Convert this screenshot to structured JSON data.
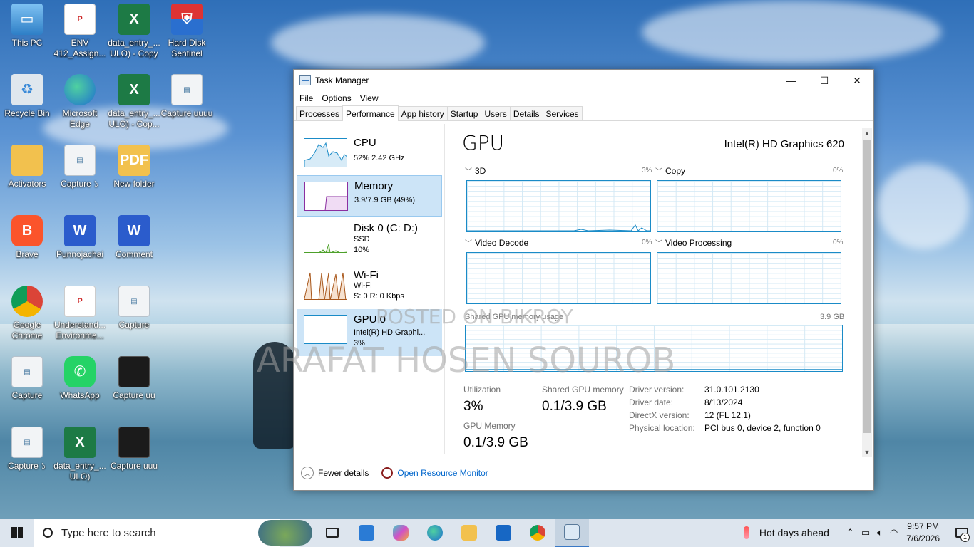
{
  "desktop": {
    "icons": [
      {
        "label": "This PC",
        "glyph": "▭"
      },
      {
        "label": "ENV 412_Assign...",
        "glyph": "P"
      },
      {
        "label": "data_entry_... ULO) - Copy",
        "glyph": "X"
      },
      {
        "label": "Hard Disk Sentinel",
        "glyph": "⛨"
      },
      {
        "label": "Recycle Bin",
        "glyph": "♻"
      },
      {
        "label": "Microsoft Edge",
        "glyph": ""
      },
      {
        "label": "data_entry_... ULO) - Cop...",
        "glyph": "X"
      },
      {
        "label": "Capture uuuu",
        "glyph": "▤"
      },
      {
        "label": "Activators",
        "glyph": ""
      },
      {
        "label": "Capture ১",
        "glyph": "▤"
      },
      {
        "label": "New folder",
        "glyph": "PDF"
      },
      {
        "label": "Brave",
        "glyph": "B"
      },
      {
        "label": "Punnojachai",
        "glyph": "W"
      },
      {
        "label": "Comment",
        "glyph": "W"
      },
      {
        "label": "Google Chrome",
        "glyph": ""
      },
      {
        "label": "Understand... Environme...",
        "glyph": "P"
      },
      {
        "label": "Capture",
        "glyph": "▤"
      },
      {
        "label": "Capture",
        "glyph": "▤"
      },
      {
        "label": "WhatsApp",
        "glyph": "✆"
      },
      {
        "label": "Capture uu",
        "glyph": ""
      },
      {
        "label": "Capture ১",
        "glyph": "▤"
      },
      {
        "label": "data_entry_... ULO)",
        "glyph": "X"
      },
      {
        "label": "Capture uuu",
        "glyph": ""
      }
    ]
  },
  "watermark": {
    "line1": "POSTED ON BIKROY",
    "line2": "ARAFAT HOSEN SOUROB"
  },
  "task_manager": {
    "title": "Task Manager",
    "window_buttons": {
      "minimize": "—",
      "maximize": "☐",
      "close": "✕"
    },
    "menu": [
      "File",
      "Options",
      "View"
    ],
    "tabs": [
      "Processes",
      "Performance",
      "App history",
      "Startup",
      "Users",
      "Details",
      "Services"
    ],
    "active_tab": "Performance",
    "resources": [
      {
        "name": "CPU",
        "sub1": "52%  2.42 GHz",
        "sub2": "",
        "sub3": "",
        "color": "#1a8bc7"
      },
      {
        "name": "Memory",
        "sub1": "3.9/7.9 GB (49%)",
        "sub2": "",
        "sub3": "",
        "color": "#8b2fa0"
      },
      {
        "name": "Disk 0 (C: D:)",
        "sub1": "SSD",
        "sub2": "10%",
        "sub3": "",
        "color": "#4da02a"
      },
      {
        "name": "Wi-Fi",
        "sub1": "Wi-Fi",
        "sub2": "S: 0 R: 0 Kbps",
        "sub3": "",
        "color": "#a7561a"
      },
      {
        "name": "GPU 0",
        "sub1": "Intel(R) HD Graphi...",
        "sub2": "3%",
        "sub3": "",
        "color": "#1a8bc7"
      }
    ],
    "gpu": {
      "title": "GPU",
      "model": "Intel(R) HD Graphics 620",
      "graphs": [
        {
          "label": "3D",
          "pct": "3%"
        },
        {
          "label": "Copy",
          "pct": "0%"
        },
        {
          "label": "Video Decode",
          "pct": "0%"
        },
        {
          "label": "Video Processing",
          "pct": "0%"
        }
      ],
      "shared_label": "Shared GPU memory usage",
      "shared_max": "3.9 GB",
      "stats": {
        "utilization_label": "Utilization",
        "utilization_value": "3%",
        "shared_mem_label": "Shared GPU memory",
        "shared_mem_value": "0.1/3.9 GB",
        "gpu_mem_label": "GPU Memory",
        "gpu_mem_value": "0.1/3.9 GB"
      },
      "info": [
        {
          "key": "Driver version:",
          "value": "31.0.101.2130"
        },
        {
          "key": "Driver date:",
          "value": "8/13/2024"
        },
        {
          "key": "DirectX version:",
          "value": "12 (FL 12.1)"
        },
        {
          "key": "Physical location:",
          "value": "PCI bus 0, device 2, function 0"
        }
      ]
    },
    "footer": {
      "fewer_details": "Fewer details",
      "resource_monitor": "Open Resource Monitor"
    }
  },
  "taskbar": {
    "search_placeholder": "Type here to search",
    "weather": "Hot days ahead",
    "time": "9:57 PM",
    "date": "7/6/2026",
    "notification_count": "1"
  }
}
